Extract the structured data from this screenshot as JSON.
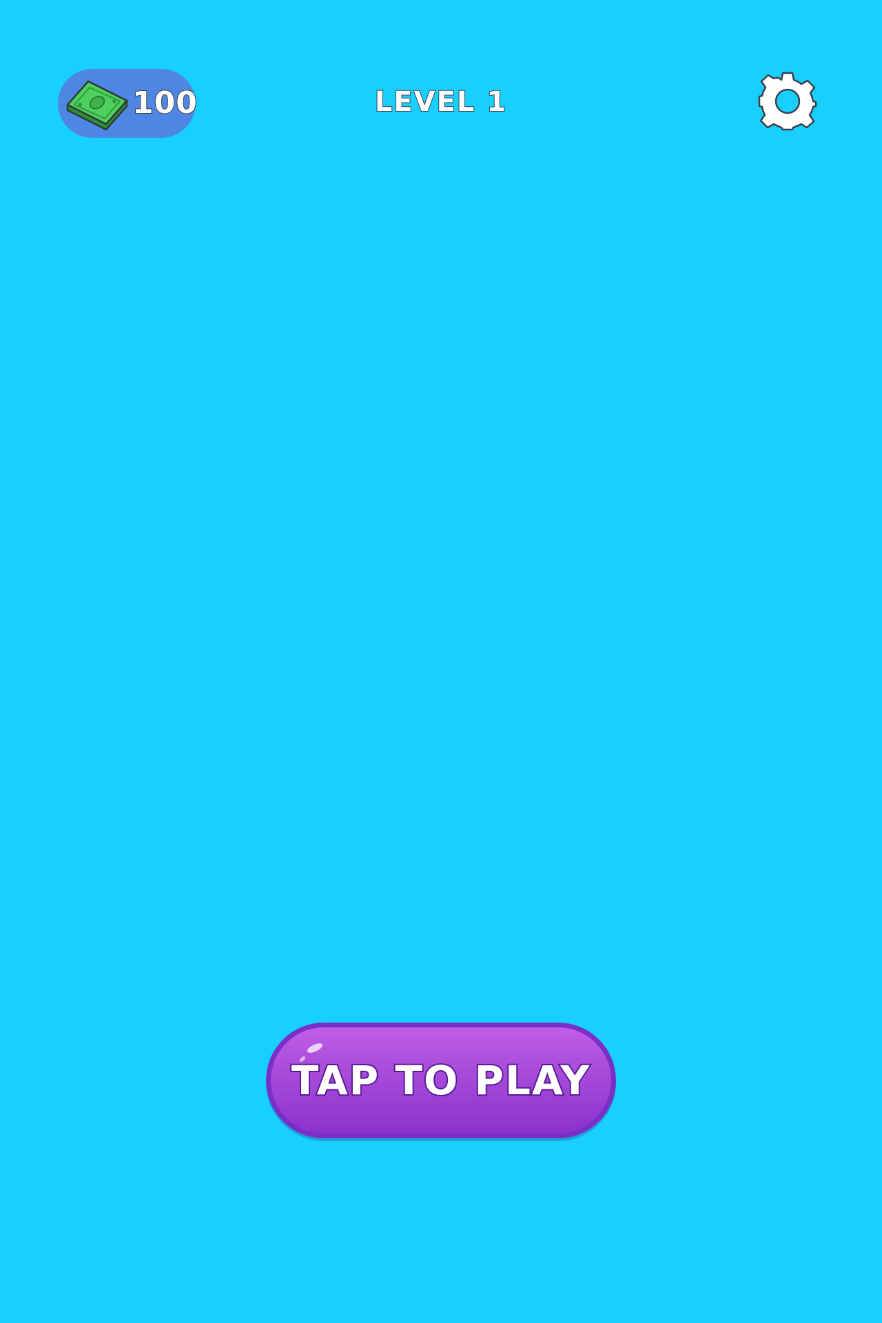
{
  "hud": {
    "currency": {
      "icon": "cash-stack-icon",
      "value": "100"
    },
    "level_label": "LEVEL 1",
    "settings_icon": "gear-icon"
  },
  "play_button": {
    "label": "TAP TO PLAY"
  },
  "colors": {
    "background": "#18cfff",
    "currency_pill": "#4f86e3",
    "play_button_top": "#c05ee6",
    "play_button_bottom": "#8a33cc",
    "play_button_border": "#7a2fc9",
    "cash_green": "#3fbf4f"
  }
}
